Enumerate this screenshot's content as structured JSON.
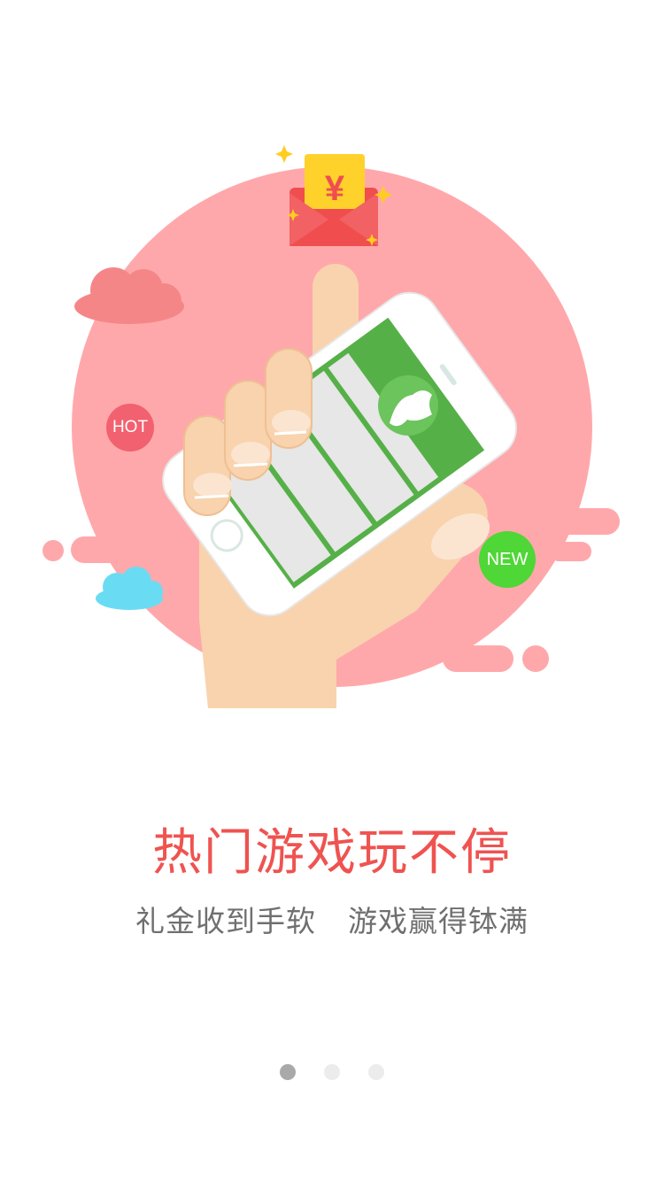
{
  "badges": {
    "hot": "HOT",
    "new": "NEW"
  },
  "envelope": {
    "symbol": "¥"
  },
  "headline": "热门游戏玩不停",
  "subline": {
    "part1": "礼金收到手软",
    "part2": "游戏赢得钵满"
  },
  "pager": {
    "total": 3,
    "active_index": 0
  },
  "colors": {
    "headline": "#ef5350",
    "subline": "#6f6f6f",
    "circle": "#ffa8ab",
    "dot_active": "#a9a9a9",
    "dot_inactive": "#ececec",
    "screen_green": "#56b048"
  }
}
